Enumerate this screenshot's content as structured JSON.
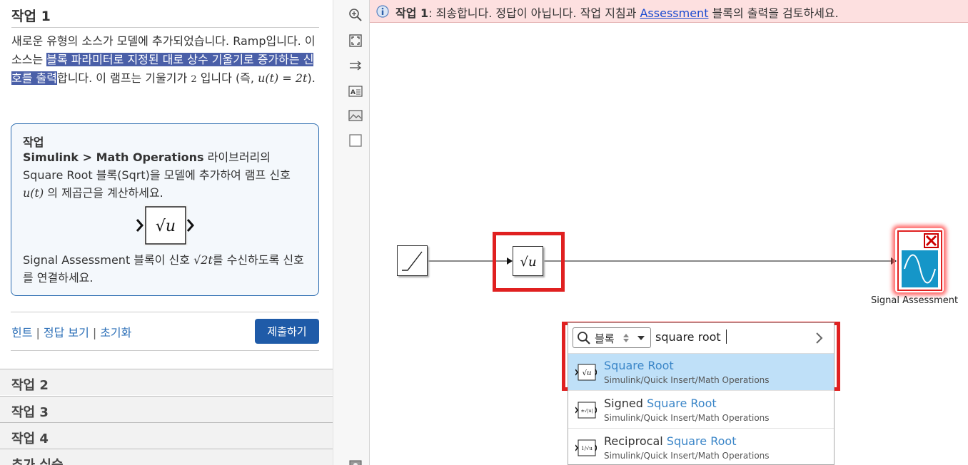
{
  "left": {
    "task1_title": "작업 1",
    "desc_a": "새로운 유형의 소스가 모델에 추가되었습니다. Ramp입니다. 이 소스는 ",
    "desc_highlight": "블록 파라미터로 지정된 대로 상수 기울기로 증가하는 신호를 출력",
    "desc_b": "합니다. 이 램프는 기울기가 ",
    "desc_slope": "2",
    "desc_c": " 입니다 (즉, ",
    "desc_formula": "u(t) = 2t",
    "desc_d": ").",
    "task_box": {
      "heading": "작업",
      "bold_path": "Simulink > Math Operations",
      "text_a": " 라이브러리의 Square Root 블록(Sqrt)을 모델에 추가하여 램프 신호 ",
      "formula_u": "u(t)",
      "text_b": " 의 제곱근을 계산하세요.",
      "block_glyph": "√u",
      "text_c": "Signal Assessment 블록이 신호 ",
      "formula_sqrt": "√2t",
      "text_d": "를 수신하도록 신호를 연결하세요."
    },
    "links": {
      "hint": "힌트",
      "show_answer": "정답 보기",
      "reset": "초기화"
    },
    "submit_label": "제출하기",
    "accordion": [
      "작업 2",
      "작업 3",
      "작업 4",
      "추가 실습"
    ]
  },
  "banner": {
    "task_label": "작업 1",
    "text_a": ": 죄송합니다. 정답이 아닙니다. 작업 지침과 ",
    "link": "Assessment",
    "text_b": " 블록의 출력을 검토하세요."
  },
  "canvas": {
    "sqrt_glyph": "√u",
    "signal_assessment_label": "Signal Assessment"
  },
  "quick_insert": {
    "scope_label": "블록",
    "query": "square root",
    "results": [
      {
        "prefix": "",
        "match": "Square Root",
        "path": "Simulink/Quick Insert/Math Operations",
        "icon": "√u"
      },
      {
        "prefix": "Signed ",
        "match": "Square Root",
        "path": "Simulink/Quick Insert/Math Operations",
        "icon": "±√|u|"
      },
      {
        "prefix": "Reciprocal ",
        "match": "Square Root",
        "path": "Simulink/Quick Insert/Math Operations",
        "icon": "1/√u"
      }
    ]
  },
  "colors": {
    "accent": "#1f5ba8",
    "link": "#2c6fb7",
    "highlight": "#4a5fa8",
    "error_red": "#e02020",
    "banner_bg": "#fde0e0",
    "selected_row": "#bfe0f8",
    "assessment_blue": "#1596c8"
  }
}
